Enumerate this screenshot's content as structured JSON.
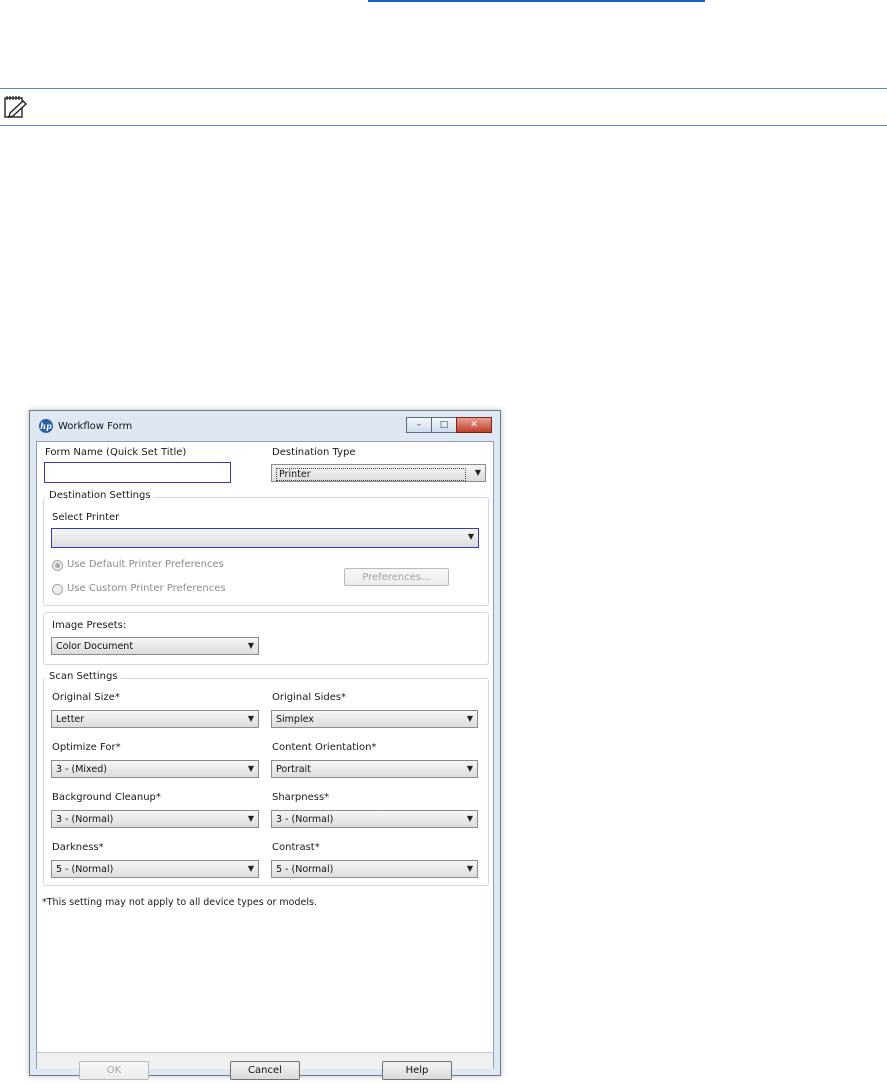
{
  "window": {
    "title": "Workflow Form",
    "logo_text": "hp",
    "minimize_glyph": "–",
    "maximize_glyph": "□",
    "close_glyph": "✕"
  },
  "form": {
    "name_label": "Form Name (Quick Set Title)",
    "name_value": "",
    "destination_type_label": "Destination Type",
    "destination_type_value": "Printer"
  },
  "destination_settings": {
    "title": "Destination Settings",
    "select_printer_label": "Select Printer",
    "select_printer_value": "",
    "default_prefs_label": "Use Default Printer Preferences",
    "custom_prefs_label": "Use Custom Printer Preferences",
    "preferences_button": "Preferences..."
  },
  "image_presets": {
    "label": "Image Presets:",
    "value": "Color Document"
  },
  "scan_settings": {
    "title": "Scan Settings",
    "original_size_label": "Original Size*",
    "original_size_value": "Letter",
    "original_sides_label": "Original Sides*",
    "original_sides_value": "Simplex",
    "optimize_for_label": "Optimize For*",
    "optimize_for_value": "3 - (Mixed)",
    "content_orientation_label": "Content Orientation*",
    "content_orientation_value": "Portrait",
    "background_cleanup_label": "Background Cleanup*",
    "background_cleanup_value": "3 - (Normal)",
    "sharpness_label": "Sharpness*",
    "sharpness_value": "3 - (Normal)",
    "darkness_label": "Darkness*",
    "darkness_value": "5 - (Normal)",
    "contrast_label": "Contrast*",
    "contrast_value": "5 - (Normal)"
  },
  "footnote": "*This setting may not apply to all device types or models.",
  "buttons": {
    "ok": "OK",
    "cancel": "Cancel",
    "help": "Help"
  },
  "icons": {
    "note": "note-pad-icon",
    "dropdown": "chevron-down-icon"
  },
  "colors": {
    "rule": "#4d8ecf",
    "link": "#1d5fbf",
    "close_button": "#c0402a"
  }
}
